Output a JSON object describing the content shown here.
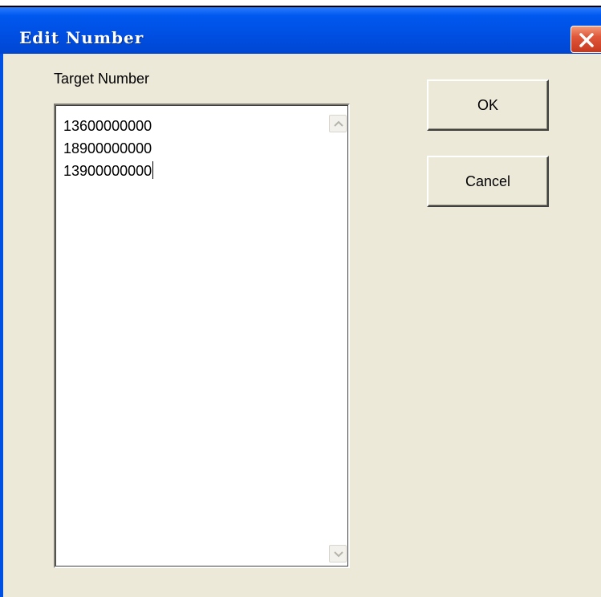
{
  "dialog": {
    "title": "Edit Number",
    "close_icon": "close-icon",
    "colors": {
      "titlebar": "#0050e4",
      "close_button": "#e0573a",
      "body": "#ece9d8"
    }
  },
  "form": {
    "label": "Target Number",
    "numbers": [
      "13600000000",
      "18900000000",
      "13900000000"
    ],
    "scroll_up_icon": "chevron-up-icon",
    "scroll_down_icon": "chevron-down-icon"
  },
  "buttons": {
    "ok_label": "OK",
    "cancel_label": "Cancel"
  }
}
